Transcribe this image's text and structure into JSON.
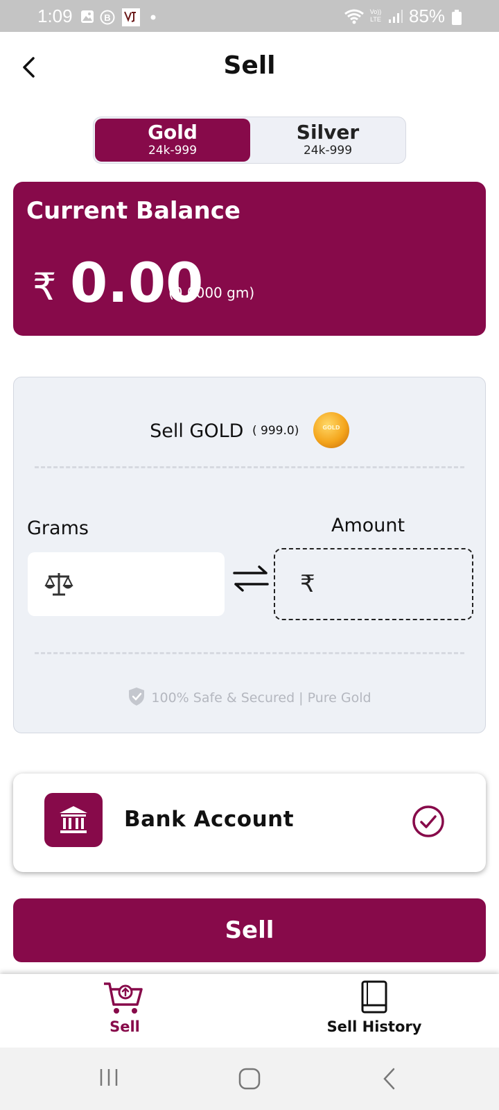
{
  "status_bar": {
    "time": "1:09",
    "battery": "85%",
    "network": "Vo)) LTE"
  },
  "header": {
    "title": "Sell",
    "back_icon": "chevron-left-icon"
  },
  "metal_toggle": {
    "options": [
      {
        "name": "Gold",
        "purity": "24k-999",
        "selected": true
      },
      {
        "name": "Silver",
        "purity": "24k-999",
        "selected": false
      }
    ]
  },
  "balance": {
    "label": "Current Balance",
    "currency": "₹",
    "amount": "0.00",
    "grams": "(0.0000 gm)"
  },
  "sell_panel": {
    "heading": "Sell GOLD",
    "purity": "( 999.0)",
    "coin_text": "GOLD",
    "grams_label": "Grams",
    "amount_label": "Amount",
    "amount_currency": "₹",
    "grams_value": "",
    "amount_value": "",
    "secure_note": "100% Safe & Secured | Pure Gold"
  },
  "payout": {
    "label": "Bank Account",
    "selected": true
  },
  "actions": {
    "sell_label": "Sell"
  },
  "bottom_nav": {
    "items": [
      {
        "label": "Sell",
        "icon": "cart-upload-icon",
        "active": true
      },
      {
        "label": "Sell History",
        "icon": "book-icon",
        "active": false
      }
    ]
  },
  "colors": {
    "brand": "#870a4a",
    "panel_bg": "#eef1f6",
    "muted_text": "#b4b7bf"
  }
}
